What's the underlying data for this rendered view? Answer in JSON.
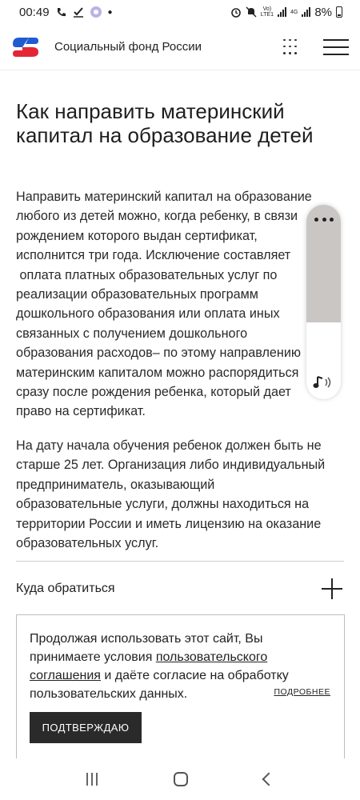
{
  "status_bar": {
    "time": "00:49",
    "battery": "8%",
    "network_top": "Vo)",
    "network_bottom": "LTE1",
    "network_4g": "4G"
  },
  "header": {
    "site_title": "Социальный фонд России",
    "brand_colors": {
      "blue": "#1f5bd1",
      "red": "#e32636"
    }
  },
  "article": {
    "title_lines": [
      "Как направить материнский",
      "капитал на образование детей"
    ],
    "paragraph1_lines": [
      "Направить материнский капитал на образование",
      "любого из детей можно, когда ребенку, в связи",
      "рождением которого выдан сертификат,",
      "исполнится три года. Исключение составляет",
      " оплата платных образовательных услуг по",
      "реализации образовательных программ",
      "дошкольного образования или оплата иных",
      "связанных с получением дошкольного",
      "образования расходов– по этому направлению",
      "материнским капиталом можно распорядиться",
      "сразу после рождения ребенка, который дает",
      "право на сертификат."
    ],
    "paragraph2_lines": [
      "На дату начала обучения ребенок должен быть не",
      "старше 25 лет. Организация либо индивидуальный",
      "предприниматель, оказывающий",
      "образовательные услуги, должны находиться на",
      "территории России и иметь лицензию на оказание",
      "образовательных услуг."
    ]
  },
  "accordion": {
    "title": "Куда обратиться"
  },
  "cookie_banner": {
    "text_before": "Продолжая использовать этот сайт, Вы принимаете условия ",
    "link_text": "пользовательского соглашения",
    "text_after": " и даёте согласие на обработку пользовательских данных.",
    "more_link": "ПОДРОБНЕЕ",
    "confirm_button": "ПОДТВЕРЖДАЮ"
  },
  "reader_widget": {
    "icons": [
      "more-dots-icon",
      "speaker-icon"
    ]
  },
  "nav_bar": {
    "icons": [
      "recent-apps-icon",
      "home-icon",
      "back-icon"
    ]
  }
}
